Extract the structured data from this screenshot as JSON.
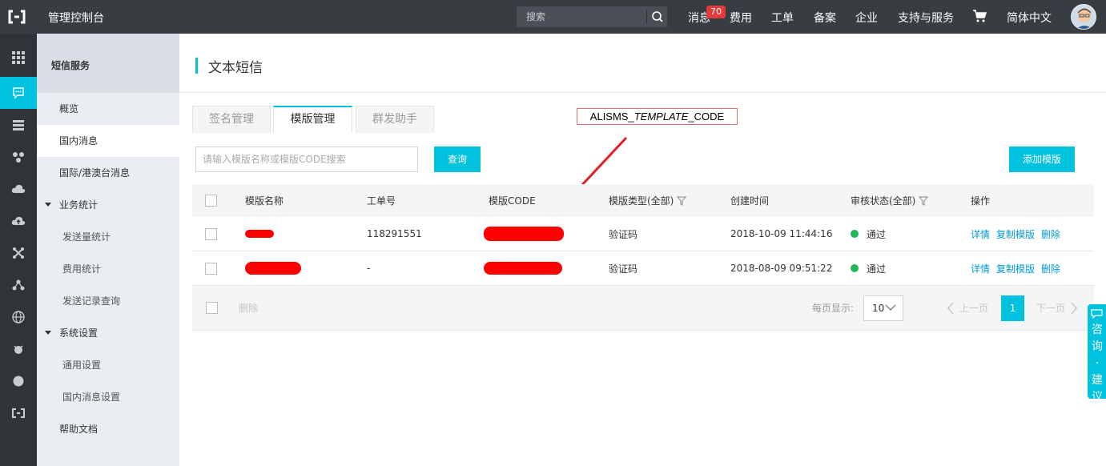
{
  "topbar": {
    "title": "管理控制台",
    "search_placeholder": "搜索",
    "nav": {
      "messages": "消息",
      "messages_badge": "70",
      "fees": "费用",
      "tickets": "工单",
      "filing": "备案",
      "enterprise": "企业",
      "support": "支持与服务",
      "language": "简体中文"
    }
  },
  "side": {
    "header": "短信服务",
    "items": [
      {
        "label": "概览"
      },
      {
        "label": "国内消息"
      },
      {
        "label": "国际/港澳台消息"
      },
      {
        "label": "业务统计"
      },
      {
        "label": "发送量统计"
      },
      {
        "label": "费用统计"
      },
      {
        "label": "发送记录查询"
      },
      {
        "label": "系统设置"
      },
      {
        "label": "通用设置"
      },
      {
        "label": "国内消息设置"
      },
      {
        "label": "帮助文档"
      }
    ]
  },
  "main": {
    "page_title": "文本短信",
    "tabs": [
      {
        "label": "签名管理"
      },
      {
        "label": "模版管理"
      },
      {
        "label": "群发助手"
      }
    ],
    "annotation": {
      "prefix": "ALISMS_",
      "italic": "TEMPLATE",
      "suffix": "_CODE"
    },
    "search_placeholder": "请输入模版名称或模版CODE搜索",
    "query_button": "查询",
    "add_button": "添加模版",
    "table": {
      "columns": [
        "模版名称",
        "工单号",
        "模版CODE",
        "模版类型(全部)",
        "创建时间",
        "审核状态(全部)",
        "操作"
      ],
      "rows": [
        {
          "ticket": "118291551",
          "type": "验证码",
          "created": "2018-10-09 11:44:16",
          "status": "通过"
        },
        {
          "ticket": "-",
          "type": "验证码",
          "created": "2018-08-09 09:51:22",
          "status": "通过"
        }
      ],
      "actions": {
        "detail": "详情",
        "copy": "复制模版",
        "delete": "删除"
      }
    },
    "footer": {
      "delete": "删除",
      "per_page_label": "每页显示:",
      "per_page_value": "10",
      "prev": "上一页",
      "current_page": "1",
      "next": "下一页"
    }
  },
  "feedback": {
    "chars": [
      "咨",
      "询",
      "·",
      "建",
      "议"
    ]
  },
  "colors": {
    "accent": "#00c1de",
    "topbar": "#373d41",
    "rail": "#2f3438",
    "status_ok": "#1db954",
    "redaction": "#ff0000"
  }
}
